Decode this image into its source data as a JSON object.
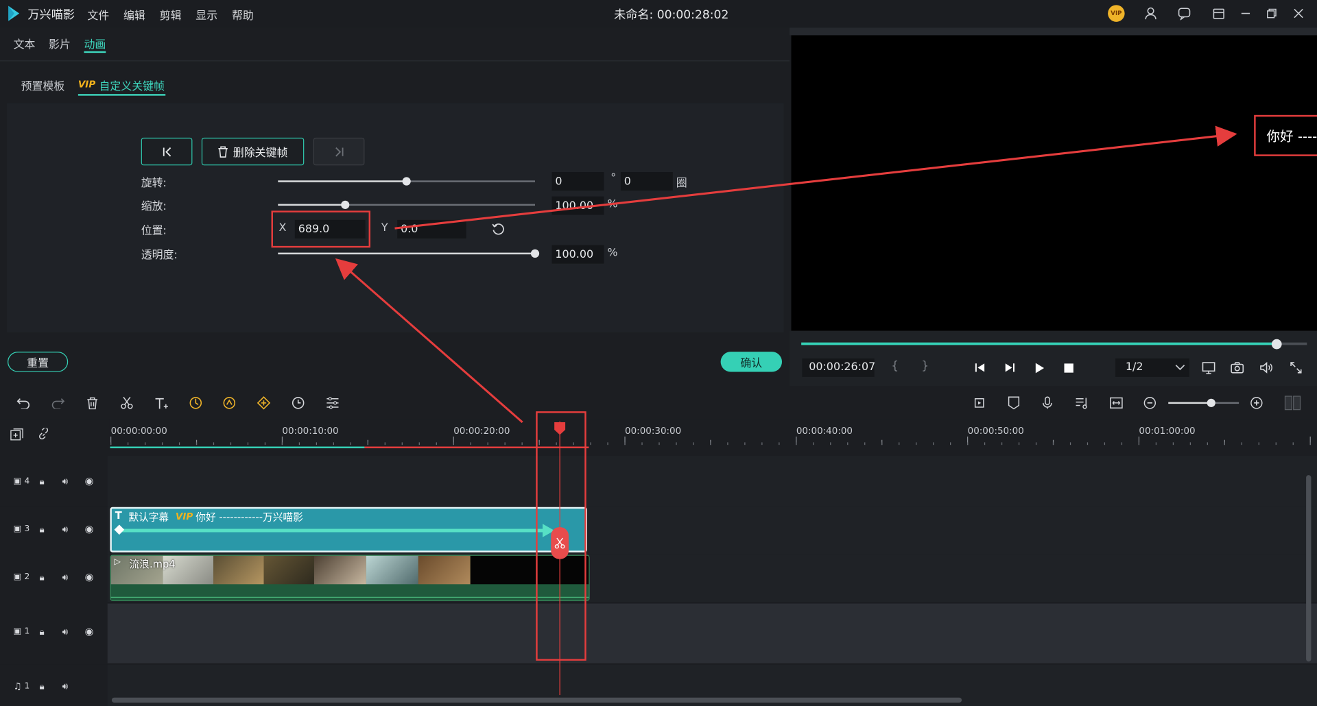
{
  "app": {
    "name": "万兴喵影",
    "title": "未命名: 00:00:28:02",
    "vip_badge": "VIP"
  },
  "menu": [
    "文件",
    "编辑",
    "剪辑",
    "显示",
    "帮助"
  ],
  "tabs": [
    "文本",
    "影片",
    "动画"
  ],
  "subtabs": {
    "preset": "预置模板",
    "vip": "VIP",
    "custom": "自定义关键帧"
  },
  "keyframe": {
    "delete_label": "删除关键帧"
  },
  "props": {
    "rotate": {
      "label": "旋转:",
      "value": "0",
      "unit": "°",
      "turns": "0",
      "turns_unit": "圈",
      "level": 0.5
    },
    "scale": {
      "label": "缩放:",
      "value": "100.00",
      "unit": "%",
      "level": 0.26
    },
    "position": {
      "label": "位置:",
      "x_label": "X",
      "x": "689.0",
      "y_label": "Y",
      "y": "0.0"
    },
    "opacity": {
      "label": "透明度:",
      "value": "100.00",
      "unit": "%",
      "level": 1.0
    }
  },
  "buttons": {
    "reset": "重置",
    "confirm": "确认"
  },
  "preview": {
    "overlay_text": "你好 ----",
    "time": "00:00:26:07",
    "brace_open": "{",
    "brace_close": "}",
    "quality": "1/2",
    "progress": 0.94
  },
  "ruler": [
    "00:00:00:00",
    "00:00:10:00",
    "00:00:20:00",
    "00:00:30:00",
    "00:00:40:00",
    "00:00:50:00",
    "00:01:00:00"
  ],
  "tracks": {
    "t4": "4",
    "t3": "3",
    "t2": "2",
    "t1": "1",
    "a1": "1"
  },
  "clips": {
    "title_clip": "默认字幕",
    "title_vip": "VIP",
    "title_text": "你好 ------------万兴喵影",
    "video_clip": "流浪.mp4"
  },
  "colors": {
    "accent": "#35d0b5",
    "red": "#e53d3d",
    "clip_text": "#2a9cab",
    "clip_video": "#2c7a55"
  }
}
